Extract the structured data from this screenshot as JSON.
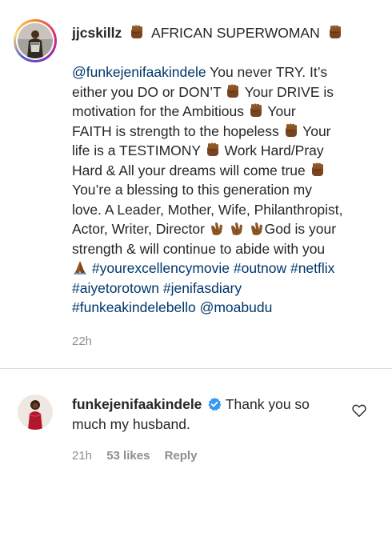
{
  "post": {
    "username": "jjcskillz",
    "title": "AFRICAN SUPERWOMAN",
    "mention_funke": "@funkejenifaakindele",
    "l1": " You never TRY. It’s",
    "l2a": "either you DO or DON’T ",
    "l2b": " Your DRIVE is",
    "l3a": "motivation for the Ambitious ",
    "l3b": " Your",
    "l4a": "FAITH is strength to the hopeless ",
    "l4b": " Your",
    "l5a": "life is a TESTIMONY ",
    "l5b": " Work Hard/Pray",
    "l6": "Hard & All your dreams will come true ",
    "l7": "You’re a blessing to this generation my",
    "l8": "love. A Leader, Mother, Wife, Philanthropist,",
    "l9a": "Actor, Writer, Director ",
    "l9b": "God is your",
    "l10": "strength & will continue to abide with you",
    "hashtag_1": "#yourexcellencymovie",
    "hashtag_2": "#outnow",
    "hashtag_3": "#netflix",
    "hashtag_4": "#aiyetorotown",
    "hashtag_5": "#jenifasdiary",
    "hashtag_6": "#funkeakindelebello",
    "mention_moabudu": "@moabudu",
    "time": "22h"
  },
  "reply": {
    "username": "funkejenifaakindele",
    "text_1": " Thank you so",
    "text_2": "much my husband.",
    "time": "21h",
    "likes": "53 likes",
    "reply_label": "Reply"
  },
  "icons": {
    "fist": "raised-fist-icon",
    "clap": "clapping-hands-icon",
    "pray": "folded-hands-icon",
    "verified": "verified-badge-icon",
    "heart": "heart-outline-icon"
  },
  "colors": {
    "link": "#00376b",
    "text": "#262626",
    "muted": "#8e8e8e",
    "verified": "#3897f0",
    "emoji_skin": "#8d5524"
  }
}
